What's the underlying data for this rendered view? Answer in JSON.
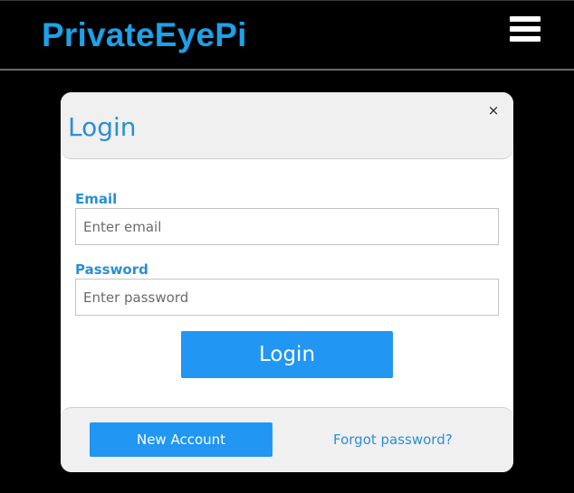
{
  "header": {
    "brand": "PrivateEyePi",
    "menu_icon": "hamburger-menu-icon"
  },
  "modal": {
    "title": "Login",
    "close_label": "×",
    "email": {
      "label": "Email",
      "placeholder": "Enter email",
      "value": ""
    },
    "password": {
      "label": "Password",
      "placeholder": "Enter password",
      "value": ""
    },
    "login_button": "Login",
    "footer": {
      "new_account_button": "New Account",
      "forgot_link": "Forgot password?"
    }
  },
  "colors": {
    "background": "#000000",
    "brand": "#1da1e8",
    "accent": "#2196f3",
    "label": "#2a8fd4",
    "panel": "#f0f0f0"
  }
}
